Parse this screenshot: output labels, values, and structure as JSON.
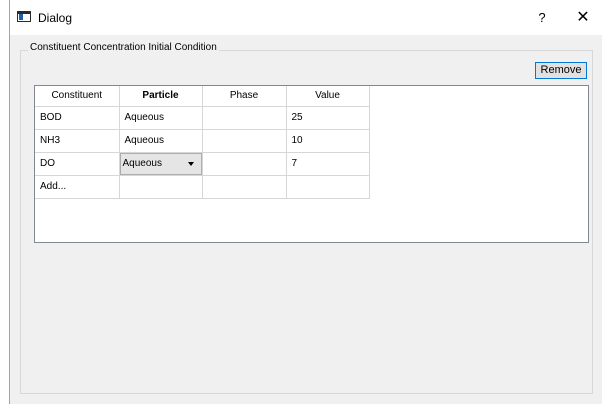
{
  "window": {
    "title": "Dialog",
    "help_label": "?",
    "close_label": "✕"
  },
  "group": {
    "title": "Constituent Concentration Initial Condition"
  },
  "toolbar": {
    "remove_label": "Remove"
  },
  "table": {
    "headers": [
      "Constituent",
      "Particle",
      "Phase",
      "Value"
    ],
    "rows": [
      {
        "constituent": "BOD",
        "particle": "Aqueous",
        "phase": "",
        "value": "25"
      },
      {
        "constituent": "NH3",
        "particle": "Aqueous",
        "phase": "",
        "value": "10"
      },
      {
        "constituent": "DO",
        "particle": "Aqueous",
        "phase": "",
        "value": "7"
      },
      {
        "constituent": "Add...",
        "particle": "",
        "phase": "",
        "value": ""
      }
    ]
  }
}
